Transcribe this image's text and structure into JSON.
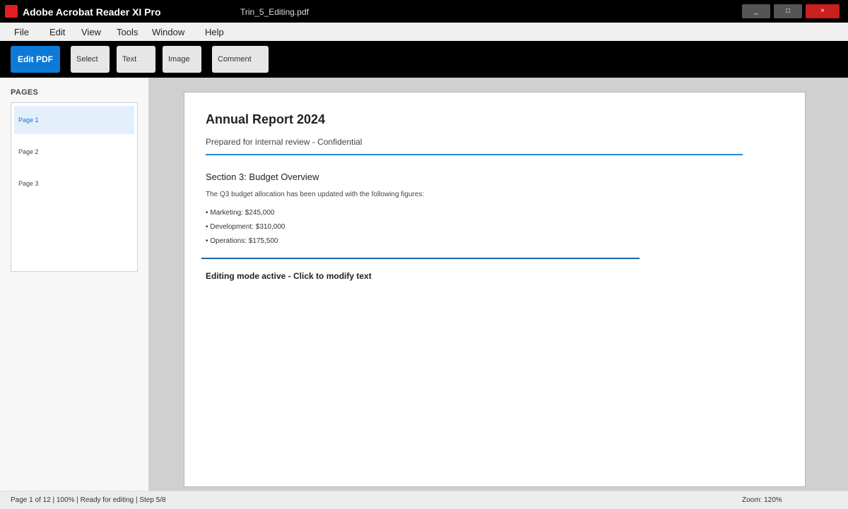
{
  "titlebar": {
    "app_title": "Adobe Acrobat Reader XI Pro",
    "doc_title": "Trin_5_Editing.pdf",
    "minimize_label": "_",
    "maximize_label": "□",
    "close_label": "×"
  },
  "menu": [
    "File",
    "Edit",
    "View",
    "Tools",
    "Window",
    "Help"
  ],
  "toolbar": {
    "edit_pdf": "Edit PDF",
    "select": "Select",
    "text": "Text",
    "image": "Image",
    "comment": "Comment"
  },
  "sidebar": {
    "title": "PAGES",
    "pages": [
      "Page 1",
      "Page 2",
      "Page 3"
    ],
    "active_page": "Page 1"
  },
  "document": {
    "title": "Annual Report 2024",
    "subtitle": "Prepared for internal review - Confidential",
    "section_heading": "Section 3: Budget Overview",
    "body": "The Q3 budget allocation has been updated with the following figures:",
    "bullets": [
      "• Marketing: $245,000",
      "• Development: $310,000",
      "• Operations: $175,500"
    ],
    "edit_note": "Editing mode active - Click to modify text"
  },
  "status": {
    "left": "Page 1 of 12 | 100% | Ready for editing | Step 5/8",
    "zoom": "Zoom: 120%"
  },
  "colors": {
    "accent": "#0d7ad8",
    "logo": "#e0201c",
    "close": "#c8201c",
    "rule": "#2b86cc"
  }
}
